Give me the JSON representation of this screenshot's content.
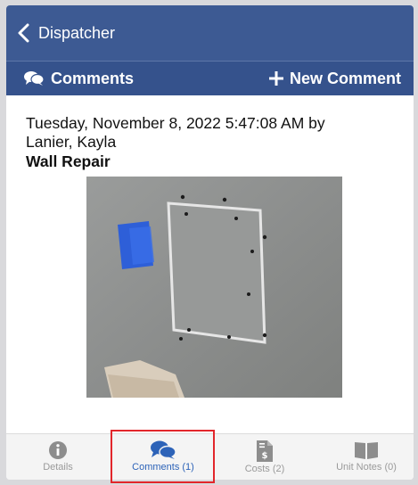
{
  "nav": {
    "back_label": "Dispatcher"
  },
  "subbar": {
    "section_label": "Comments",
    "new_comment_label": "New Comment"
  },
  "comment": {
    "meta_line1": "Tuesday, November 8, 2022 5:47:08 AM by",
    "meta_line2": "Lanier, Kayla",
    "title": "Wall Repair"
  },
  "tabs": [
    {
      "label": "Details",
      "icon": "info-icon"
    },
    {
      "label": "Comments (1)",
      "icon": "comments-icon",
      "active": true
    },
    {
      "label": "Costs (2)",
      "icon": "cost-document-icon"
    },
    {
      "label": "Unit Notes (0)",
      "icon": "book-icon"
    }
  ],
  "colors": {
    "navbar": "#3d5a93",
    "subbar": "#35528c",
    "active_tab": "#2d63b8",
    "inactive_tab": "#9a9a9a",
    "highlight": "#e2262b"
  }
}
